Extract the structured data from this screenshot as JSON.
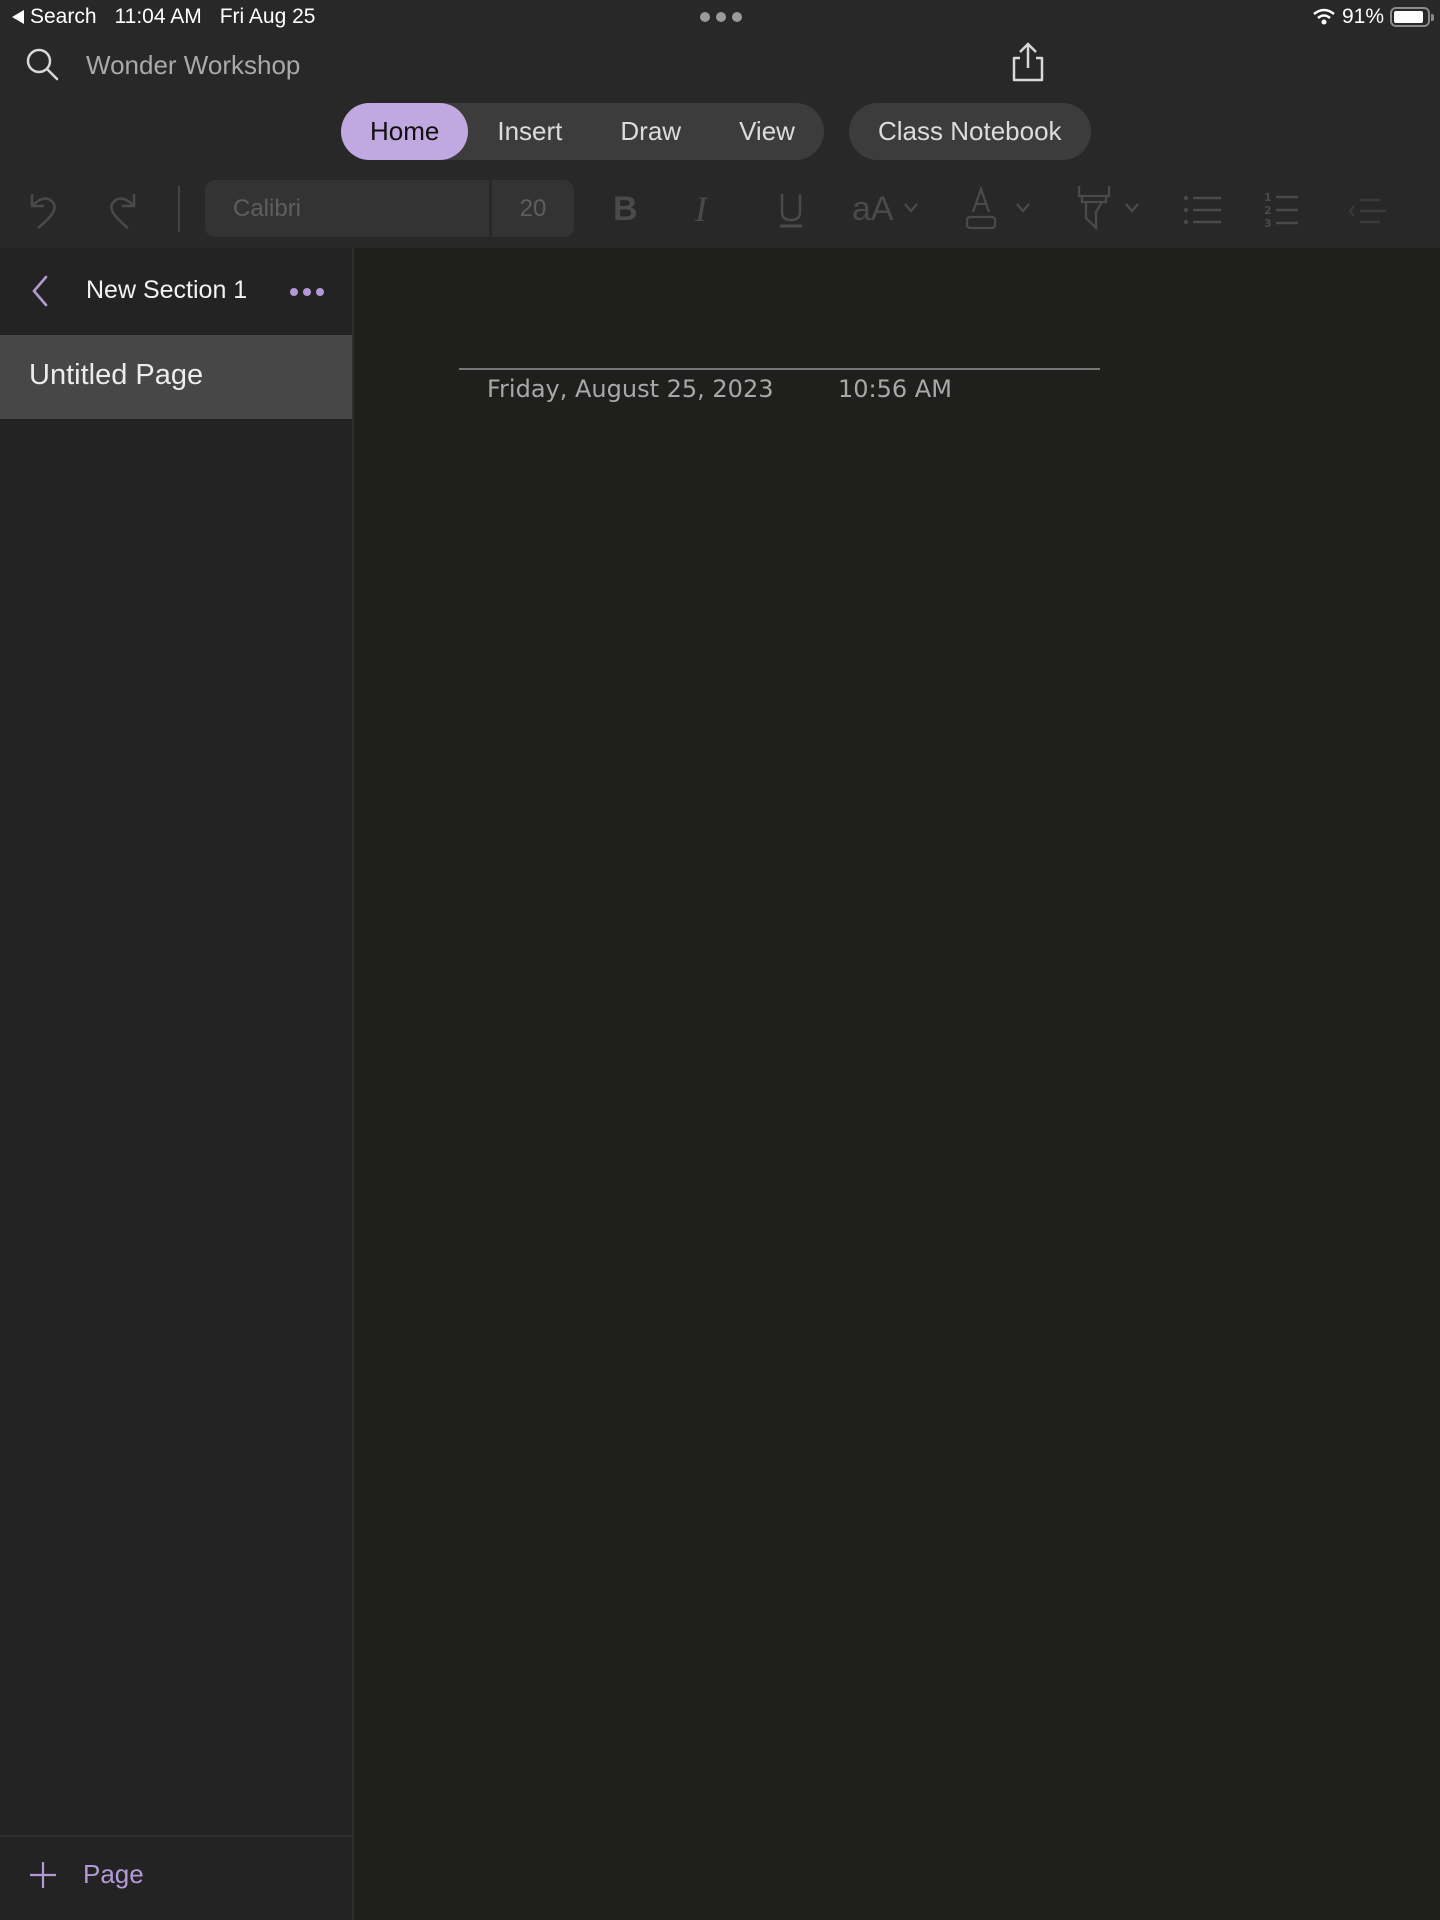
{
  "status_bar": {
    "back_app": "Search",
    "time": "11:04 AM",
    "date": "Fri Aug 25",
    "battery": "91%",
    "battery_level": 0.91
  },
  "header": {
    "notebook_title": "Wonder Workshop",
    "icons": [
      "search-icon",
      "share-icon",
      "gear-icon",
      "expand-icon"
    ]
  },
  "tabs": [
    {
      "label": "Home",
      "active": true
    },
    {
      "label": "Insert",
      "active": false
    },
    {
      "label": "Draw",
      "active": false
    },
    {
      "label": "View",
      "active": false
    }
  ],
  "class_notebook_label": "Class Notebook",
  "toolbar": {
    "font_name": "Calibri",
    "font_size": "20",
    "icons": [
      "undo-icon",
      "redo-icon",
      "bold-icon",
      "italic-icon",
      "underline-icon",
      "font-size-icon",
      "font-color-icon",
      "highlighter-icon",
      "bullet-list-icon",
      "numbered-list-icon",
      "outdent-icon"
    ]
  },
  "sidebar": {
    "section_title": "New Section 1",
    "pages": [
      {
        "label": "Untitled Page",
        "selected": true
      }
    ],
    "add_page_label": "Page"
  },
  "page": {
    "date": "Friday, August 25, 2023",
    "time": "10:56 AM"
  },
  "colors": {
    "accent": "#c0a9e1",
    "accent_text": "#b39ad6",
    "background": "#1f1f1e",
    "topbar": "#282828",
    "selected_page": "#474747"
  }
}
